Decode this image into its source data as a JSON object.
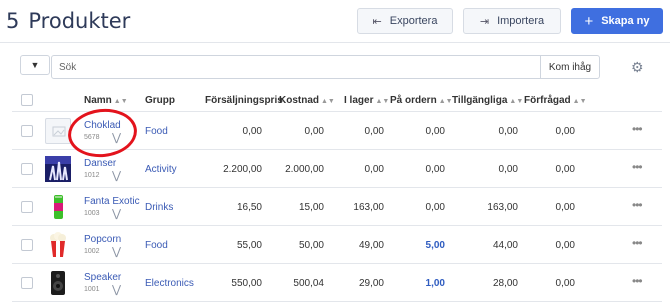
{
  "header": {
    "count": "5",
    "title": "Produkter",
    "export_label": "Exportera",
    "import_label": "Importera",
    "new_label": "Skapa ny"
  },
  "search": {
    "placeholder": "Sök",
    "remember_label": "Kom ihåg"
  },
  "table": {
    "headers": {
      "name": "Namn",
      "group": "Grupp",
      "price": "Försäljningspris",
      "cost": "Kostnad",
      "stock": "I lager",
      "ordered": "På ordern",
      "available": "Tillgängliga",
      "requested": "Förfrågad"
    },
    "rows": [
      {
        "name": "Choklad",
        "code": "5678",
        "group": "Food",
        "price": "0,00",
        "cost": "0,00",
        "stock": "0,00",
        "ordered": "0,00",
        "available": "0,00",
        "requested": "0,00",
        "thumb": "placeholder"
      },
      {
        "name": "Danser",
        "code": "1012",
        "group": "Activity",
        "price": "2.200,00",
        "cost": "2.000,00",
        "stock": "0,00",
        "ordered": "0,00",
        "available": "0,00",
        "requested": "0,00",
        "thumb": "dancer"
      },
      {
        "name": "Fanta Exotic",
        "code": "1003",
        "group": "Drinks",
        "price": "16,50",
        "cost": "15,00",
        "stock": "163,00",
        "ordered": "0,00",
        "available": "163,00",
        "requested": "0,00",
        "thumb": "can"
      },
      {
        "name": "Popcorn",
        "code": "1002",
        "group": "Food",
        "price": "55,00",
        "cost": "50,00",
        "stock": "49,00",
        "ordered": "5,00",
        "available": "44,00",
        "requested": "0,00",
        "thumb": "popcorn"
      },
      {
        "name": "Speaker",
        "code": "1001",
        "group": "Electronics",
        "price": "550,00",
        "cost": "500,04",
        "stock": "29,00",
        "ordered": "1,00",
        "available": "28,00",
        "requested": "0,00",
        "thumb": "speaker"
      }
    ]
  },
  "colors": {
    "accent": "#3f6fe0",
    "link": "#3b5bb5",
    "annotation": "#e3131c"
  }
}
